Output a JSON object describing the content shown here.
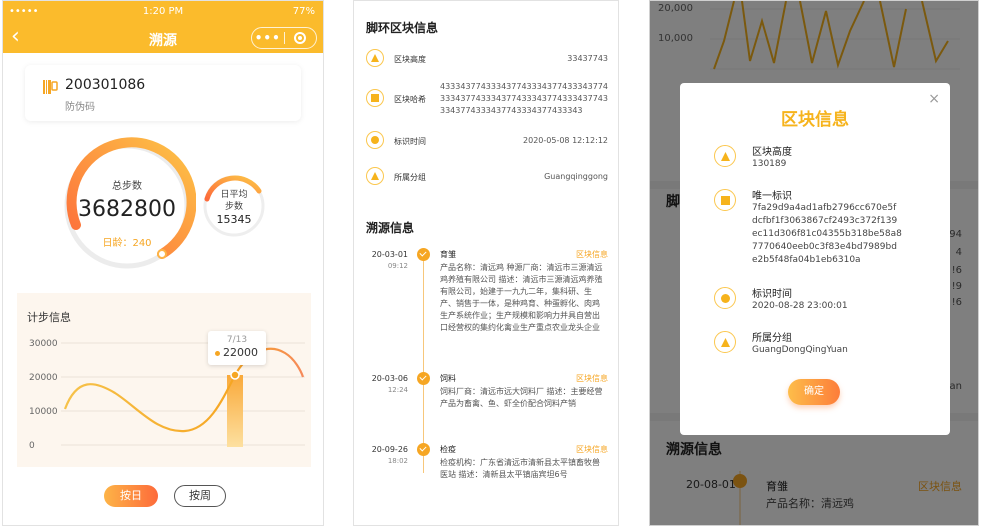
{
  "phone": {
    "status": {
      "signal": "••••• ",
      "time": "1:20 PM",
      "battery": "77%"
    },
    "nav": {
      "title": "溯源",
      "more": "•••"
    },
    "code": {
      "number": "200301086",
      "label": "防伪码"
    },
    "total": {
      "label": "总步数",
      "value": "3682800",
      "age": "日龄：240"
    },
    "avg": {
      "label_line1": "日平均",
      "label_line2": "步数",
      "value": "15345"
    },
    "step_chart_title": "计步信息",
    "chart_data": {
      "type": "area",
      "ylim": [
        0,
        30000
      ],
      "yticks": [
        "30000",
        "20000",
        "10000",
        "0"
      ],
      "tooltip": {
        "date": "7/13",
        "value": "22000"
      }
    },
    "buttons": {
      "day": "按日",
      "week": "按周"
    }
  },
  "chain": {
    "title": "脚环区块信息",
    "rows": [
      {
        "key": "区块高度",
        "value": "33437743"
      },
      {
        "key": "区块哈希",
        "value": "4333437743334377433343774333437743334377433343774333437743334377433343774333437743334377433343"
      },
      {
        "key": "标识时间",
        "value": "2020-05-08  12:12:12"
      },
      {
        "key": "所属分组",
        "value": "Guangqinggong"
      }
    ],
    "trace_title": "溯源信息",
    "timeline": [
      {
        "date": "20-03-01",
        "time": "09:12",
        "title": "育雏",
        "tag": "区块信息",
        "desc": "产品名称：清远鸡 种源厂商：清远市三源清远鸡养殖有限公司 描述：清远市三源清远鸡养殖有限公司，始建于一九九二年，集科研、生产、销售于一体，是种鸡育、种蛋孵化、肉鸡生产系统作业；生产规模和影响力并具自营出口经营权的集约化禽业生产重点农业龙头企业"
      },
      {
        "date": "20-03-06",
        "time": "12:24",
        "title": "饲料",
        "tag": "区块信息",
        "desc": "饲料厂商：清远市远大饲料厂 描述：主要经营产品为畜禽、鱼、虾全价配合饲料产销"
      },
      {
        "date": "20-09-26",
        "time": "18:02",
        "title": "检疫",
        "tag": "区块信息",
        "desc": "检疫机构：广东省清远市清新县太平镇畜牧兽医站 描述：清新县太平镇庙宾坦6号"
      }
    ]
  },
  "modal_screen": {
    "bg": {
      "ylabels": [
        "20,000",
        "10,000"
      ],
      "partial_title": "脚",
      "side_vals": [
        "94",
        "4",
        "!6",
        "!9",
        "!6",
        "an"
      ],
      "trace_title": "溯源信息",
      "trace_date": "20-08-01",
      "trace_item": "育雏",
      "trace_tag": "区块信息",
      "trace_line": "产品名称：清远鸡"
    },
    "modal": {
      "title": "区块信息",
      "close": "×",
      "rows": [
        {
          "key": "区块高度",
          "value": "130189"
        },
        {
          "key": "唯一标识",
          "value": "7fa29d9a4ad1afb2796cc670e5fdcfbf1f3063867cf2493c372f139ec11d306f81c04355b318be58a87770640eeb0c3f83e4bd7989bde2b5f48fa04b1eb6310a"
        },
        {
          "key": "标识时间",
          "value": "2020-08-28 23:00:01"
        },
        {
          "key": "所属分组",
          "value": "GuangDongQingYuan"
        }
      ],
      "confirm": "确定"
    }
  },
  "colors": {
    "primary": "#fbbb2c",
    "accent": "#f6a623",
    "gradient_end": "#fd6a3a"
  }
}
